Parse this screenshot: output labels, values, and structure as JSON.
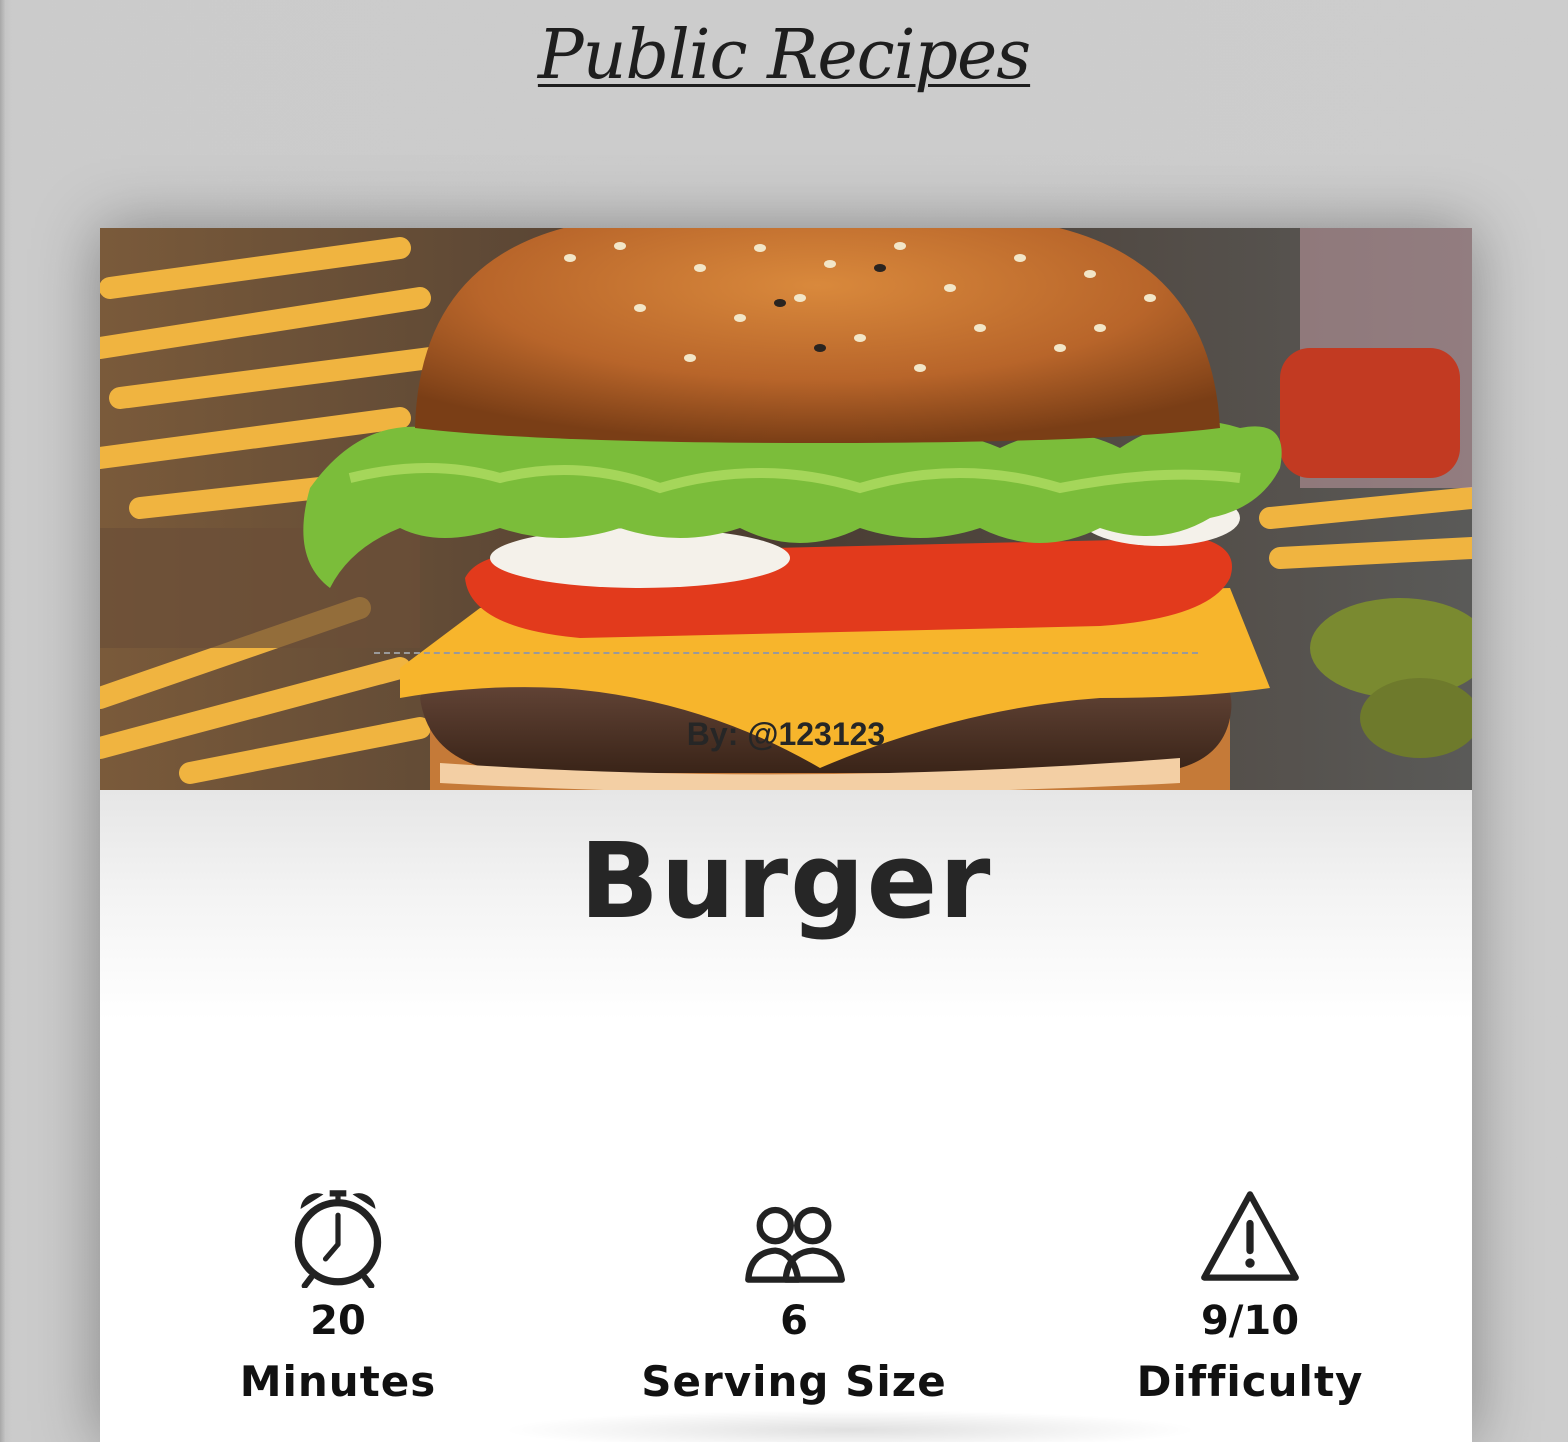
{
  "page": {
    "title": "Public Recipes"
  },
  "recipe": {
    "name": "Burger",
    "author": "By: @123123",
    "image_icon": "burger-photo",
    "stats": [
      {
        "icon": "alarm-clock-icon",
        "value": "20",
        "label": "Minutes"
      },
      {
        "icon": "people-icon",
        "value": "6",
        "label": "Serving Size"
      },
      {
        "icon": "warning-icon",
        "value": "9/10",
        "label": "Difficulty"
      }
    ]
  },
  "colors": {
    "page_background": "#cdcdcd",
    "card_background": "#ffffff",
    "text_dark": "#262626"
  }
}
